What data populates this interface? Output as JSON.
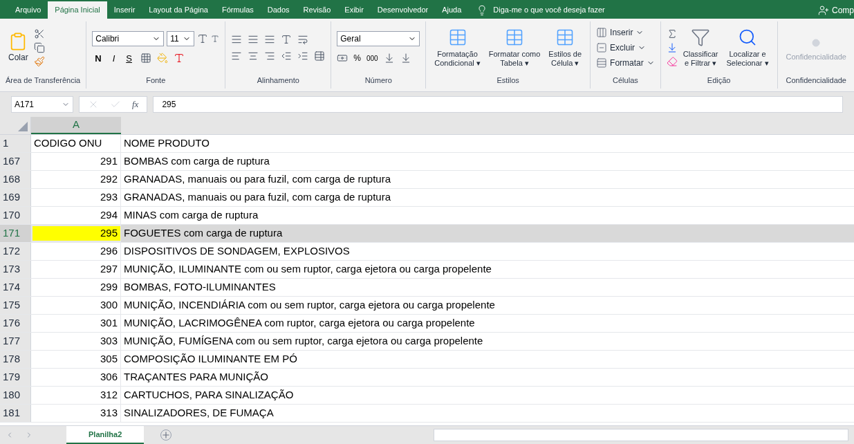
{
  "menu_tabs": [
    {
      "label": "Arquivo",
      "selected": false
    },
    {
      "label": "Página Inicial",
      "selected": true
    },
    {
      "label": "Inserir",
      "selected": false
    },
    {
      "label": "Layout da Página",
      "selected": false
    },
    {
      "label": "Fórmulas",
      "selected": false
    },
    {
      "label": "Dados",
      "selected": false
    },
    {
      "label": "Revisão",
      "selected": false
    },
    {
      "label": "Exibir",
      "selected": false
    },
    {
      "label": "Desenvolvedor",
      "selected": false
    },
    {
      "label": "Ajuda",
      "selected": false
    }
  ],
  "tell_me": "Diga-me o que você deseja fazer",
  "share": "Comp",
  "ribbon_groups": [
    {
      "kind": "clipboard",
      "label": "Área de Transferência",
      "paste": "Colar"
    },
    {
      "kind": "font",
      "label": "Fonte",
      "font": "Calibri",
      "size": "11",
      "bold": "N",
      "italic": "I",
      "underline": "S"
    },
    {
      "kind": "align",
      "label": "Alinhamento"
    },
    {
      "kind": "number",
      "label": "Número",
      "format": "Geral",
      "percent": "%",
      "thousands": "000"
    },
    {
      "kind": "large",
      "label": "Estilos",
      "disabled": false,
      "buttons": [
        [
          "Formatação",
          "Condicional ▾"
        ],
        [
          "Formatar como",
          "Tabela ▾"
        ],
        [
          "Estilos de",
          "Célula ▾"
        ]
      ]
    },
    {
      "kind": "small",
      "label": "Células",
      "items": [
        "Inserir",
        "Excluir",
        "Formatar"
      ]
    },
    {
      "kind": "editing",
      "label": "Edição",
      "buttons": [
        [
          "Classificar",
          "e Filtrar ▾"
        ],
        [
          "Localizar e",
          "Selecionar ▾"
        ]
      ]
    },
    {
      "kind": "large",
      "label": "Confidencialidade",
      "disabled": true,
      "buttons": [
        [
          "Confidencialidade"
        ]
      ]
    }
  ],
  "name_box": "A171",
  "formula": "295",
  "function_label": "fx",
  "columns": [
    "A"
  ],
  "rows": [
    {
      "number": "1",
      "kind": "header",
      "code": "CODIGO ONU",
      "name": "NOME PRODUTO",
      "selected": false,
      "highlighted": false
    },
    {
      "number": "167",
      "kind": "data",
      "code": "291",
      "name": "BOMBAS com carga de ruptura",
      "selected": false,
      "highlighted": false
    },
    {
      "number": "168",
      "kind": "data",
      "code": "292",
      "name": "GRANADAS, manuais ou para fuzil, com carga de ruptura",
      "selected": false,
      "highlighted": false
    },
    {
      "number": "169",
      "kind": "data",
      "code": "293",
      "name": "GRANADAS, manuais ou para fuzil, com carga de ruptura",
      "selected": false,
      "highlighted": false
    },
    {
      "number": "170",
      "kind": "data",
      "code": "294",
      "name": "MINAS com carga de ruptura",
      "selected": false,
      "highlighted": false
    },
    {
      "number": "171",
      "kind": "data",
      "code": "295",
      "name": "FOGUETES com carga de ruptura",
      "selected": true,
      "highlighted": true
    },
    {
      "number": "172",
      "kind": "data",
      "code": "296",
      "name": "DISPOSITIVOS DE SONDAGEM, EXPLOSIVOS",
      "selected": false,
      "highlighted": false
    },
    {
      "number": "173",
      "kind": "data",
      "code": "297",
      "name": "MUNIÇÃO, ILUMINANTE com ou sem ruptor, carga ejetora ou carga propelente",
      "selected": false,
      "highlighted": false
    },
    {
      "number": "174",
      "kind": "data",
      "code": "299",
      "name": "BOMBAS, FOTO-ILUMINANTES",
      "selected": false,
      "highlighted": false
    },
    {
      "number": "175",
      "kind": "data",
      "code": "300",
      "name": "MUNIÇÃO, INCENDIÁRIA com ou sem ruptor, carga ejetora ou carga propelente",
      "selected": false,
      "highlighted": false
    },
    {
      "number": "176",
      "kind": "data",
      "code": "301",
      "name": "MUNIÇÃO, LACRIMOGÊNEA com ruptor, carga ejetora ou carga propelente",
      "selected": false,
      "highlighted": false
    },
    {
      "number": "177",
      "kind": "data",
      "code": "303",
      "name": "MUNIÇÃO, FUMÍGENA com ou sem ruptor, carga ejetora ou carga propelente",
      "selected": false,
      "highlighted": false
    },
    {
      "number": "178",
      "kind": "data",
      "code": "305",
      "name": "COMPOSIÇÃO ILUMINANTE EM PÓ",
      "selected": false,
      "highlighted": false
    },
    {
      "number": "179",
      "kind": "data",
      "code": "306",
      "name": "TRAÇANTES PARA MUNIÇÃO",
      "selected": false,
      "highlighted": false
    },
    {
      "number": "180",
      "kind": "data",
      "code": "312",
      "name": "CARTUCHOS, PARA SINALIZAÇÃO",
      "selected": false,
      "highlighted": false
    },
    {
      "number": "181",
      "kind": "data",
      "code": "313",
      "name": "SINALIZADORES, DE FUMAÇA",
      "selected": false,
      "highlighted": false
    }
  ],
  "sheet_tabs": [
    {
      "label": "Planilha2",
      "selected": true
    }
  ]
}
